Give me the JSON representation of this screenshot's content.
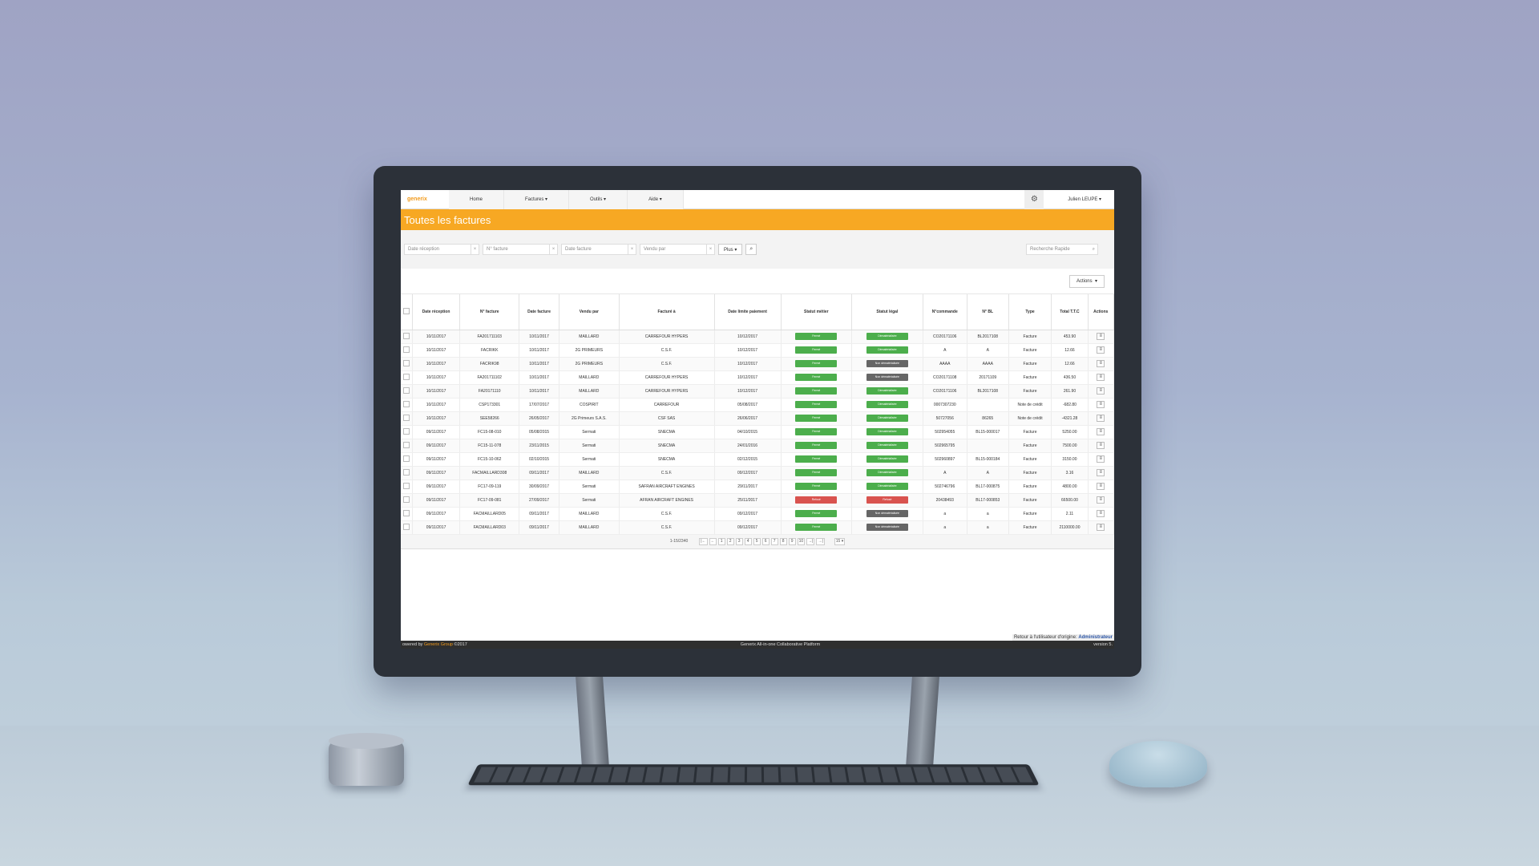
{
  "app": {
    "logo": "generix",
    "nav": [
      "Home",
      "Factures ▾",
      "Outils ▾",
      "Aide ▾"
    ],
    "settings_icon": "gear-icon",
    "user": "Julien LEUPE ▾"
  },
  "page_title": "Toutes les factures",
  "filters": {
    "date_reception": "Date réception",
    "num_facture": "N° facture",
    "date_facture": "Date facture",
    "vendu_par": "Vendu par",
    "plus_label": "Plus ▾",
    "search_icon": "search-icon",
    "quick_search": "Recherche Rapide"
  },
  "actions_label": "Actions",
  "table": {
    "headers": [
      "Date réception",
      "N° facture",
      "Date facture",
      "Vendu par",
      "Facturé à",
      "Date limite paiement",
      "Statut métier",
      "Statut légal",
      "N°commande",
      "N° BL",
      "Type",
      "Total T.T.C",
      "Actions"
    ],
    "rows": [
      [
        "10/11/2017",
        "FA201711103",
        "10/11/2017",
        "MAILLARD",
        "CARREFOUR HYPERS",
        "10/12/2017",
        "Fermé",
        "Dématérialisée",
        "CO20171106",
        "BL2017108",
        "Facture",
        "453.90"
      ],
      [
        "10/11/2017",
        "FACRIKK",
        "10/11/2017",
        "2G PRIMEURS",
        "C.S.F.",
        "10/12/2017",
        "Fermé",
        "Dématérialisée",
        "A",
        "A",
        "Facture",
        "12.66"
      ],
      [
        "10/11/2017",
        "FACRIK98",
        "10/11/2017",
        "2G PRIMEURS",
        "C.S.F.",
        "10/12/2017",
        "Fermé",
        "Non dématérialisée",
        "AAAA",
        "AAAA",
        "Facture",
        "12.66"
      ],
      [
        "10/11/2017",
        "FA201711102",
        "10/11/2017",
        "MAILLARD",
        "CARREFOUR HYPERS",
        "10/12/2017",
        "Fermé",
        "Non dématérialisée",
        "CO20171108",
        "20171109",
        "Facture",
        "436.50"
      ],
      [
        "10/11/2017",
        "FA20171110",
        "10/11/2017",
        "MAILLARD",
        "CARREFOUR HYPERS",
        "10/12/2017",
        "Fermé",
        "Dématérialisée",
        "CO20171106",
        "BL2017108",
        "Facture",
        "261.90"
      ],
      [
        "10/11/2017",
        "CSP173301",
        "17/07/2017",
        "COSPIRIT",
        "CARREFOUR",
        "05/08/2017",
        "Fermé",
        "Dématérialisée",
        "0007307230",
        "",
        "Note de crédit",
        "-682.80"
      ],
      [
        "10/11/2017",
        "SEE58266",
        "26/05/2017",
        "2G Primeurs S.A.S.",
        "CSF SAS",
        "26/06/2017",
        "Fermé",
        "Dématérialisée",
        "50727056",
        "86265",
        "Note de crédit",
        "-4321.28"
      ],
      [
        "09/11/2017",
        "FC15-08-010",
        "05/08/2015",
        "Sermati",
        "SNECMA",
        "04/10/2015",
        "Fermé",
        "Dématérialisée",
        "502954055",
        "BL15-000017",
        "Facture",
        "5250.00"
      ],
      [
        "09/11/2017",
        "FC15-11-078",
        "23/11/2015",
        "Sermati",
        "SNECMA",
        "24/01/2016",
        "Fermé",
        "Dématérialisée",
        "502965795",
        "",
        "Facture",
        "7500.00"
      ],
      [
        "09/11/2017",
        "FC15-10-062",
        "02/10/2015",
        "Sermati",
        "SNECMA",
        "02/12/2015",
        "Fermé",
        "Dématérialisée",
        "502960897",
        "BL15-000184",
        "Facture",
        "3150.00"
      ],
      [
        "09/11/2017",
        "FACMAILLARD308",
        "09/11/2017",
        "MAILLARD",
        "C.S.F.",
        "09/12/2017",
        "Fermé",
        "Dématérialisée",
        "A",
        "A",
        "Facture",
        "3.16"
      ],
      [
        "09/11/2017",
        "FC17-09-119",
        "30/09/2017",
        "Sermati",
        "SAFRAN AIRCRAFT ENGINES",
        "29/11/2017",
        "Fermé",
        "Dématérialisée",
        "502746796",
        "BL17-000875",
        "Facture",
        "4800.00"
      ],
      [
        "09/11/2017",
        "FC17-09-081",
        "27/09/2017",
        "Sermati",
        "AFRAN AIRCRAFT ENGINES",
        "25/11/2017",
        "Refusé",
        "Refusé",
        "20438493",
        "BL17-000853",
        "Facture",
        "66500.00"
      ],
      [
        "09/11/2017",
        "FACMAILLARD05",
        "09/11/2017",
        "MAILLARD",
        "C.S.F.",
        "09/12/2017",
        "Fermé",
        "Non dématérialisée",
        "a",
        "a",
        "Facture",
        "2.11"
      ],
      [
        "09/11/2017",
        "FACMAILLARD03",
        "09/11/2017",
        "MAILLARD",
        "C.S.F.",
        "09/12/2017",
        "Fermé",
        "Non dématérialisée",
        "a",
        "a",
        "Facture",
        "2110000.00"
      ]
    ],
    "row_action_icon": "list-icon"
  },
  "pager": {
    "range": "1-15/2340",
    "first": "|←",
    "prev": "←",
    "pages": [
      "1",
      "2",
      "3",
      "4",
      "5",
      "6",
      "7",
      "8",
      "9",
      "10"
    ],
    "next": "→|",
    "last": "→|",
    "per_page": "15 ▾"
  },
  "retour": {
    "text": "Retour à l'utilisateur d'origine: ",
    "link": "Administrateur"
  },
  "footer": {
    "left_prefix": "owered by ",
    "left_brand": "Generix Group",
    "left_suffix": " ©2017",
    "center": "Generix All-in-one Collaborative Platform",
    "right": "version 5."
  },
  "colors": {
    "accent": "#f7a823",
    "fermé": "#4cae4c",
    "dematerialisee": "#4cae4c",
    "non_dematerialisee": "#666666",
    "refusé": "#d9534f"
  }
}
